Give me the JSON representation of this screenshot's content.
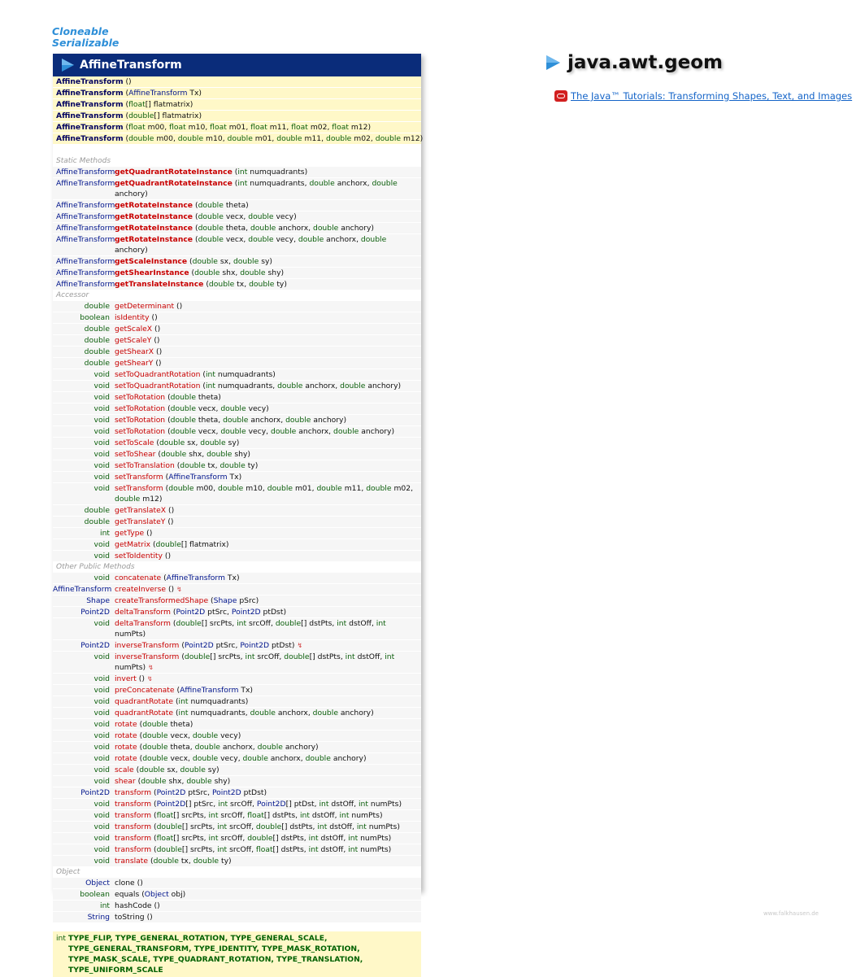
{
  "interfaces": [
    "Cloneable",
    "Serializable"
  ],
  "class_name": "AffineTransform",
  "package": {
    "name": "java.awt.geom"
  },
  "tutorial_link": "The Java™ Tutorials: Transforming Shapes, Text, and Images",
  "credit": "www.falkhausen.de",
  "constructors": [
    "()",
    "(AffineTransform Tx)",
    "(float[] flatmatrix)",
    "(double[] flatmatrix)",
    "(float m00, float m10, float m01, float m11, float m02, float m12)",
    "(double m00, double m10, double m01, double m11, double m02, double m12)"
  ],
  "groups": [
    {
      "label": "Static Methods",
      "style": "static",
      "rows": [
        {
          "type": "AffineTransform",
          "name": "getQuadrantRotateInstance",
          "params": "(int numquadrants)"
        },
        {
          "type": "AffineTransform",
          "name": "getQuadrantRotateInstance",
          "params": "(int numquadrants, double anchorx, double anchory)"
        },
        {
          "type": "AffineTransform",
          "name": "getRotateInstance",
          "params": "(double theta)"
        },
        {
          "type": "AffineTransform",
          "name": "getRotateInstance",
          "params": "(double vecx, double vecy)"
        },
        {
          "type": "AffineTransform",
          "name": "getRotateInstance",
          "params": "(double theta, double anchorx, double anchory)"
        },
        {
          "type": "AffineTransform",
          "name": "getRotateInstance",
          "params": "(double vecx, double vecy, double anchorx, double anchory)"
        },
        {
          "type": "AffineTransform",
          "name": "getScaleInstance",
          "params": "(double sx, double sy)"
        },
        {
          "type": "AffineTransform",
          "name": "getShearInstance",
          "params": "(double shx, double shy)"
        },
        {
          "type": "AffineTransform",
          "name": "getTranslateInstance",
          "params": "(double tx, double ty)"
        }
      ]
    },
    {
      "label": "Accessor",
      "style": "normal",
      "rows": [
        {
          "type": "double",
          "name": "getDeterminant",
          "params": "()"
        },
        {
          "type": "boolean",
          "name": "isIdentity",
          "params": "()"
        },
        {
          "type": "double",
          "name": "getScaleX",
          "params": "()"
        },
        {
          "type": "double",
          "name": "getScaleY",
          "params": "()"
        },
        {
          "type": "double",
          "name": "getShearX",
          "params": "()"
        },
        {
          "type": "double",
          "name": "getShearY",
          "params": "()"
        },
        {
          "type": "void",
          "name": "setToQuadrantRotation",
          "params": "(int numquadrants)"
        },
        {
          "type": "void",
          "name": "setToQuadrantRotation",
          "params": "(int numquadrants, double anchorx, double anchory)"
        },
        {
          "type": "void",
          "name": "setToRotation",
          "params": "(double theta)"
        },
        {
          "type": "void",
          "name": "setToRotation",
          "params": "(double vecx, double vecy)"
        },
        {
          "type": "void",
          "name": "setToRotation",
          "params": "(double theta, double anchorx, double anchory)"
        },
        {
          "type": "void",
          "name": "setToRotation",
          "params": "(double vecx, double vecy, double anchorx, double anchory)"
        },
        {
          "type": "void",
          "name": "setToScale",
          "params": "(double sx, double sy)"
        },
        {
          "type": "void",
          "name": "setToShear",
          "params": "(double shx, double shy)"
        },
        {
          "type": "void",
          "name": "setToTranslation",
          "params": "(double tx, double ty)"
        },
        {
          "type": "void",
          "name": "setTransform",
          "params": "(AffineTransform Tx)"
        },
        {
          "type": "void",
          "name": "setTransform",
          "params": "(double m00, double m10, double m01, double m11, double m02, double m12)"
        },
        {
          "type": "double",
          "name": "getTranslateX",
          "params": "()"
        },
        {
          "type": "double",
          "name": "getTranslateY",
          "params": "()"
        },
        {
          "type": "int",
          "name": "getType",
          "params": "()"
        },
        {
          "type": "void",
          "name": "getMatrix",
          "params": "(double[] flatmatrix)"
        },
        {
          "type": "void",
          "name": "setToIdentity",
          "params": "()"
        }
      ]
    },
    {
      "label": "Other Public Methods",
      "style": "normal",
      "rows": [
        {
          "type": "void",
          "name": "concatenate",
          "params": "(AffineTransform Tx)"
        },
        {
          "type": "AffineTransform",
          "name": "createInverse",
          "params": "()",
          "throws": "↯"
        },
        {
          "type": "Shape",
          "name": "createTransformedShape",
          "params": "(Shape pSrc)"
        },
        {
          "type": "Point2D",
          "name": "deltaTransform",
          "params": "(Point2D ptSrc, Point2D ptDst)"
        },
        {
          "type": "void",
          "name": "deltaTransform",
          "params": "(double[] srcPts, int srcOff, double[] dstPts, int dstOff, int numPts)"
        },
        {
          "type": "Point2D",
          "name": "inverseTransform",
          "params": "(Point2D ptSrc, Point2D ptDst)",
          "throws": "↯"
        },
        {
          "type": "void",
          "name": "inverseTransform",
          "params": "(double[] srcPts, int srcOff, double[] dstPts, int dstOff, int numPts)",
          "throws": "↯"
        },
        {
          "type": "void",
          "name": "invert",
          "params": "()",
          "throws": "↯"
        },
        {
          "type": "void",
          "name": "preConcatenate",
          "params": "(AffineTransform Tx)"
        },
        {
          "type": "void",
          "name": "quadrantRotate",
          "params": "(int numquadrants)"
        },
        {
          "type": "void",
          "name": "quadrantRotate",
          "params": "(int numquadrants, double anchorx, double anchory)"
        },
        {
          "type": "void",
          "name": "rotate",
          "params": "(double theta)"
        },
        {
          "type": "void",
          "name": "rotate",
          "params": "(double vecx, double vecy)"
        },
        {
          "type": "void",
          "name": "rotate",
          "params": "(double theta, double anchorx, double anchory)"
        },
        {
          "type": "void",
          "name": "rotate",
          "params": "(double vecx, double vecy, double anchorx, double anchory)"
        },
        {
          "type": "void",
          "name": "scale",
          "params": "(double sx, double sy)"
        },
        {
          "type": "void",
          "name": "shear",
          "params": "(double shx, double shy)"
        },
        {
          "type": "Point2D",
          "name": "transform",
          "params": "(Point2D ptSrc, Point2D ptDst)"
        },
        {
          "type": "void",
          "name": "transform",
          "params": "(Point2D[] ptSrc, int srcOff, Point2D[] ptDst, int dstOff, int numPts)"
        },
        {
          "type": "void",
          "name": "transform",
          "params": "(float[] srcPts, int srcOff, float[] dstPts, int dstOff, int numPts)"
        },
        {
          "type": "void",
          "name": "transform",
          "params": "(double[] srcPts, int srcOff, double[] dstPts, int dstOff, int numPts)"
        },
        {
          "type": "void",
          "name": "transform",
          "params": "(float[] srcPts, int srcOff, double[] dstPts, int dstOff, int numPts)"
        },
        {
          "type": "void",
          "name": "transform",
          "params": "(double[] srcPts, int srcOff, float[] dstPts, int dstOff, int numPts)"
        },
        {
          "type": "void",
          "name": "translate",
          "params": "(double tx, double ty)"
        }
      ]
    },
    {
      "label": "Object",
      "style": "plain",
      "rows": [
        {
          "type": "Object",
          "name": "clone",
          "params": "()"
        },
        {
          "type": "boolean",
          "name": "equals",
          "params": "(Object obj)"
        },
        {
          "type": "int",
          "name": "hashCode",
          "params": "()"
        },
        {
          "type": "String",
          "name": "toString",
          "params": "()"
        }
      ]
    }
  ],
  "constants": {
    "type": "int",
    "names": "TYPE_FLIP, TYPE_GENERAL_ROTATION, TYPE_GENERAL_SCALE, TYPE_GENERAL_TRANSFORM, TYPE_IDENTITY, TYPE_MASK_ROTATION, TYPE_MASK_SCALE, TYPE_QUADRANT_ROTATION, TYPE_TRANSLATION, TYPE_UNIFORM_SCALE"
  },
  "colors": {
    "header_bg": "#0a2c7a",
    "method_name": "#c80000",
    "ref_type": "#00148c",
    "prim_type": "#0b5e0b",
    "ctor_bg": "#fff8c8",
    "play_icon": "#2e8fd8"
  }
}
